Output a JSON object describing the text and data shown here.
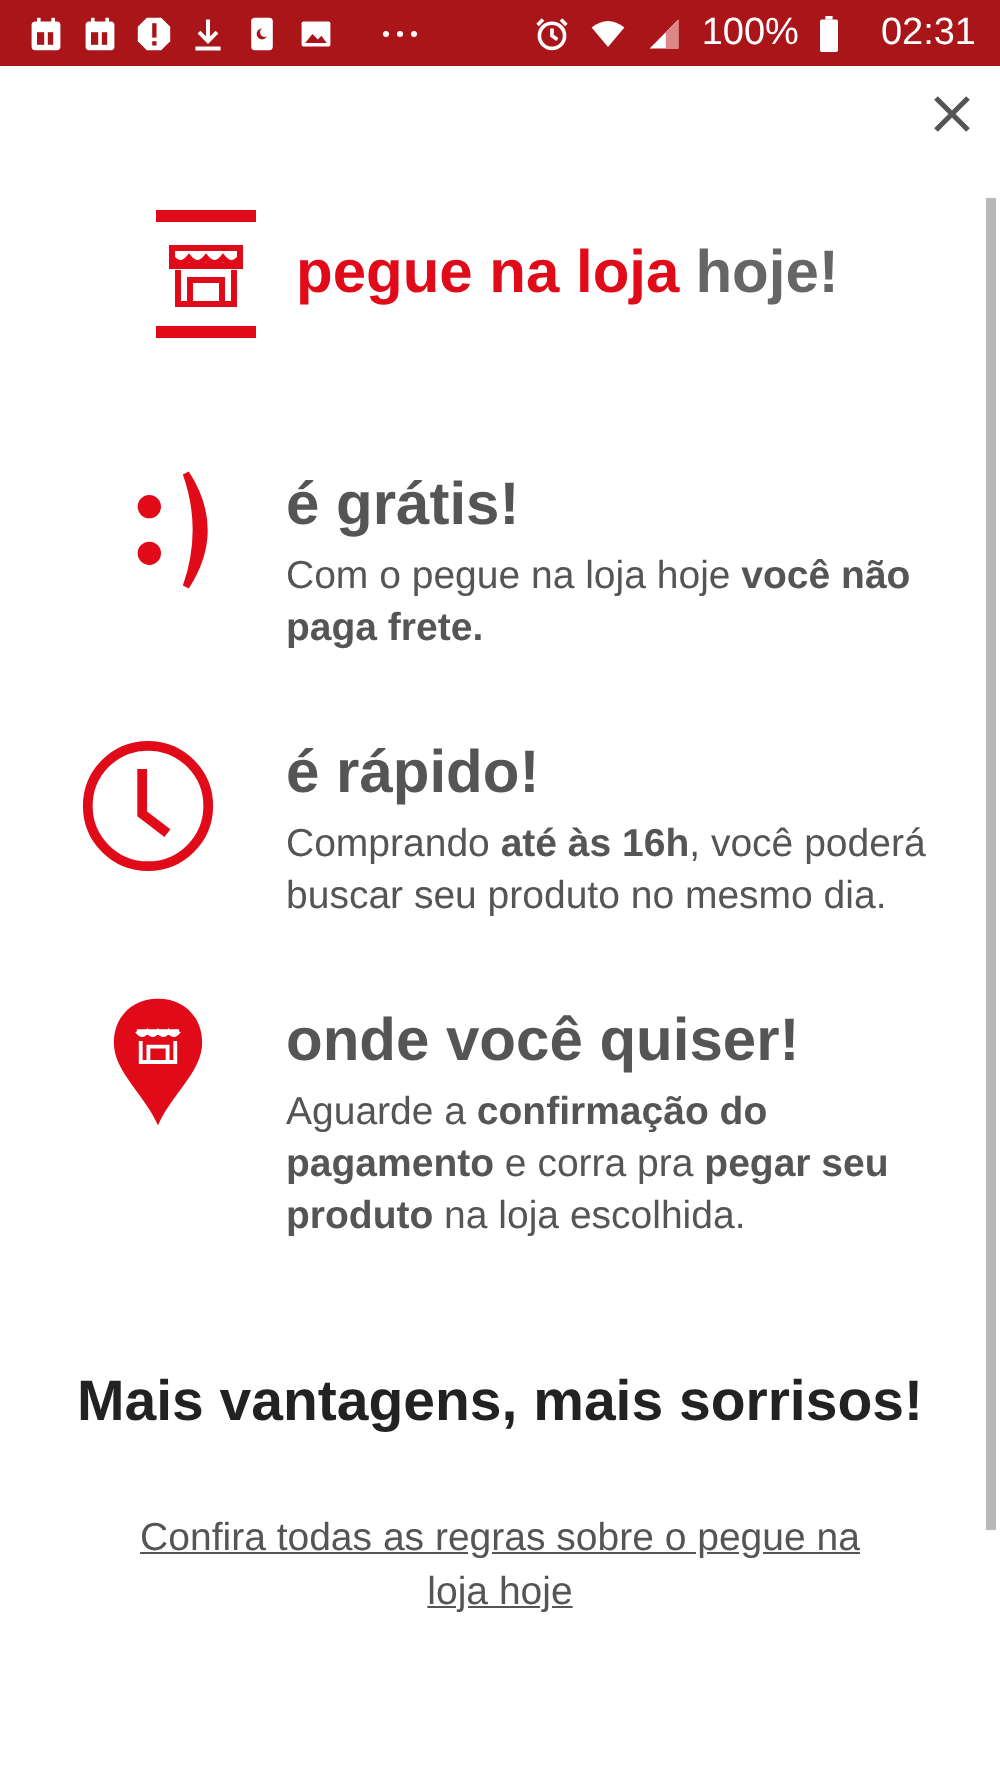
{
  "status_bar": {
    "battery": "100%",
    "time": "02:31"
  },
  "header": {
    "brand": "pegue na loja",
    "suffix": "hoje!"
  },
  "features": [
    {
      "kind": "smile",
      "title": "é grátis!",
      "text": "Com o pegue na loja hoje **você não paga frete.**"
    },
    {
      "kind": "clock",
      "title": "é rápido!",
      "text": "Comprando **até às 16h**, você poderá buscar seu produto no mesmo dia."
    },
    {
      "kind": "pin",
      "title": "onde você quiser!",
      "text": "Aguarde a **confirmação do pagamento** e corra pra **pegar seu produto** na loja escolhida."
    }
  ],
  "footer": {
    "headline": "Mais vantagens, mais sorrisos!",
    "link": "Confira todas as regras sobre o pegue na loja hoje"
  }
}
